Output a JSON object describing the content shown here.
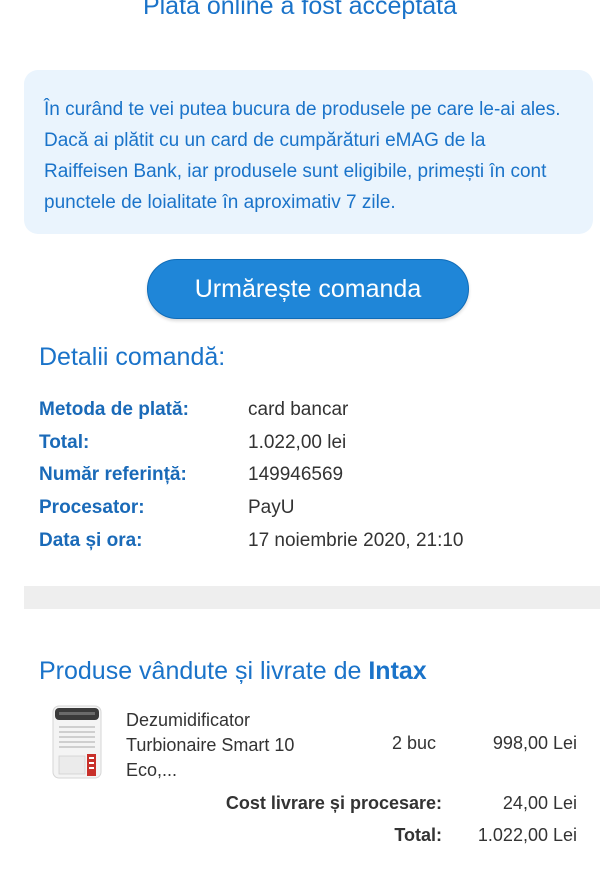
{
  "header": {
    "title": "Plata online a fost acceptată"
  },
  "info": {
    "text": "În curând te vei putea bucura de produsele pe care le-ai ales. Dacă ai plătit cu un card de cumpărături eMAG de la Raiffeisen Bank, iar produsele sunt eligibile, primești în cont punctele de loialitate în aproximativ 7 zile."
  },
  "actions": {
    "track_order_label": "Urmărește comanda"
  },
  "order_details": {
    "heading": "Detalii comandă:",
    "rows": [
      {
        "label": "Metoda de plată:",
        "value": "card bancar"
      },
      {
        "label": "Total:",
        "value": "1.022,00 lei"
      },
      {
        "label": "Număr referință:",
        "value": "149946569"
      },
      {
        "label": "Procesator:",
        "value": "PayU"
      },
      {
        "label": "Data și ora:",
        "value": "17 noiembrie 2020, 21:10"
      }
    ]
  },
  "products": {
    "heading_prefix": "Produse vândute și livrate de ",
    "vendor": "Intax",
    "items": [
      {
        "name": "Dezumidificator Turbionaire Smart 10 Eco,...",
        "quantity": "2 buc",
        "price": "998,00 Lei"
      }
    ],
    "shipping_label": "Cost livrare și procesare:",
    "shipping_value": "24,00 Lei",
    "total_label": "Total:",
    "total_value": "1.022,00 Lei"
  },
  "colors": {
    "accent": "#1a73c9",
    "button": "#1f86d8",
    "info_bg": "#eaf4fd",
    "label": "#1a6ab8"
  }
}
